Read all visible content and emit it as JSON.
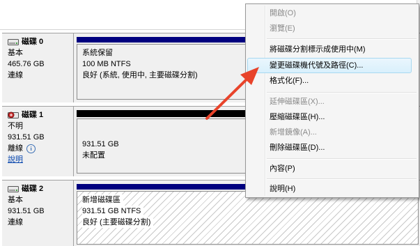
{
  "colors": {
    "primary_partition": "#00007f",
    "unallocated": "#000000",
    "menu_highlight": "#d9f0fc",
    "arrow": "#e8432a",
    "link": "#0645ad"
  },
  "disks": [
    {
      "name": "磁碟 0",
      "icon": "disk-drive-icon",
      "type": "基本",
      "size": "465.76 GB",
      "status": "連線",
      "partition": {
        "title": "系統保留",
        "size": "100 MB NTFS",
        "status": "良好 (系統, 使用中, 主要磁碟分割)"
      }
    },
    {
      "name": "磁碟 1",
      "icon": "disk-drive-offline-icon",
      "type": "不明",
      "size": "931.51 GB",
      "status": "離線",
      "help": "說明",
      "partition": {
        "size": "931.51 GB",
        "status": "未配置"
      }
    },
    {
      "name": "磁碟 2",
      "icon": "disk-drive-icon",
      "type": "基本",
      "size": "931.51 GB",
      "status": "連線",
      "partition": {
        "title": "新增磁碟區",
        "size": "931.51 GB NTFS",
        "status": "良好 (主要磁碟分割)"
      }
    }
  ],
  "context_menu": {
    "items": [
      {
        "label": "開啟(O)",
        "enabled": false
      },
      {
        "label": "瀏覽(E)",
        "enabled": false
      },
      {
        "label": "將磁碟分割標示成使用中(M)",
        "enabled": true
      },
      {
        "label": "變更磁碟機代號及路徑(C)...",
        "enabled": true,
        "highlighted": true
      },
      {
        "label": "格式化(F)...",
        "enabled": true
      },
      {
        "label": "延伸磁碟區(X)...",
        "enabled": false
      },
      {
        "label": "壓縮磁碟區(H)...",
        "enabled": true
      },
      {
        "label": "新增鏡像(A)...",
        "enabled": false
      },
      {
        "label": "刪除磁碟區(D)...",
        "enabled": true
      },
      {
        "label": "內容(P)",
        "enabled": true
      },
      {
        "label": "說明(H)",
        "enabled": true
      }
    ]
  }
}
